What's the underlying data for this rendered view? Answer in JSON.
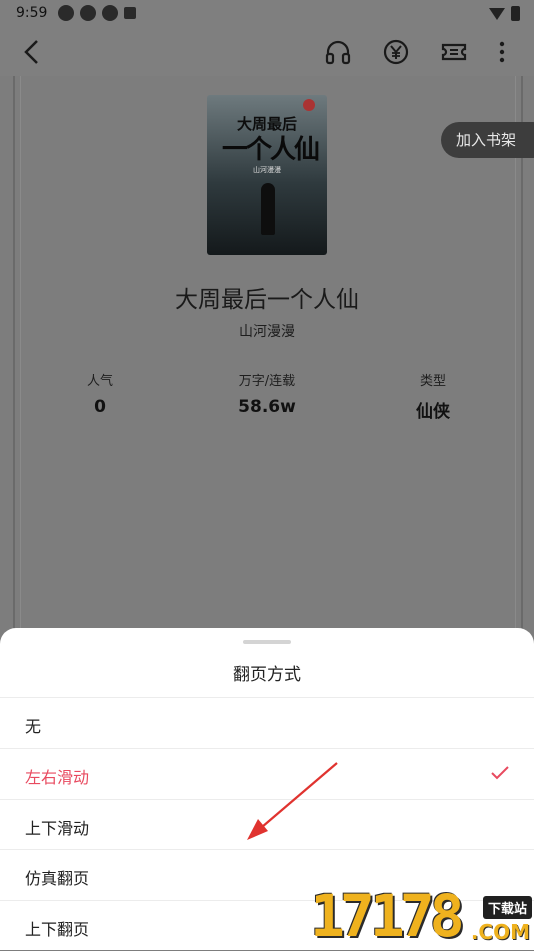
{
  "status_bar": {
    "time": "9:59",
    "icons": [
      "shutter-icon",
      "shutter-icon",
      "shutter-icon",
      "a-box-icon",
      "wifi-icon",
      "battery-icon"
    ]
  },
  "toolbar": {
    "icons": [
      "back-icon",
      "headphones-icon",
      "yuan-icon",
      "ticket-icon",
      "more-icon"
    ]
  },
  "book": {
    "cover_title_line1": "大周最后",
    "cover_title_line2": "一个人仙",
    "cover_author": "山河漫漫",
    "add_to_shelf": "加入书架",
    "title": "大周最后一个人仙",
    "author": "山河漫漫",
    "stats": [
      {
        "label": "人气",
        "value": "0"
      },
      {
        "label": "万字/连载",
        "value": "58.6w"
      },
      {
        "label": "类型",
        "value": "仙侠"
      }
    ]
  },
  "sheet": {
    "title": "翻页方式",
    "options": [
      {
        "label": "无",
        "selected": false
      },
      {
        "label": "左右滑动",
        "selected": true
      },
      {
        "label": "上下滑动",
        "selected": false
      },
      {
        "label": "仿真翻页",
        "selected": false
      },
      {
        "label": "上下翻页",
        "selected": false
      }
    ],
    "accent_color": "#e84a5f"
  },
  "watermark": {
    "digits": "17178",
    "badge": "下载站",
    "domain": ".COM"
  }
}
